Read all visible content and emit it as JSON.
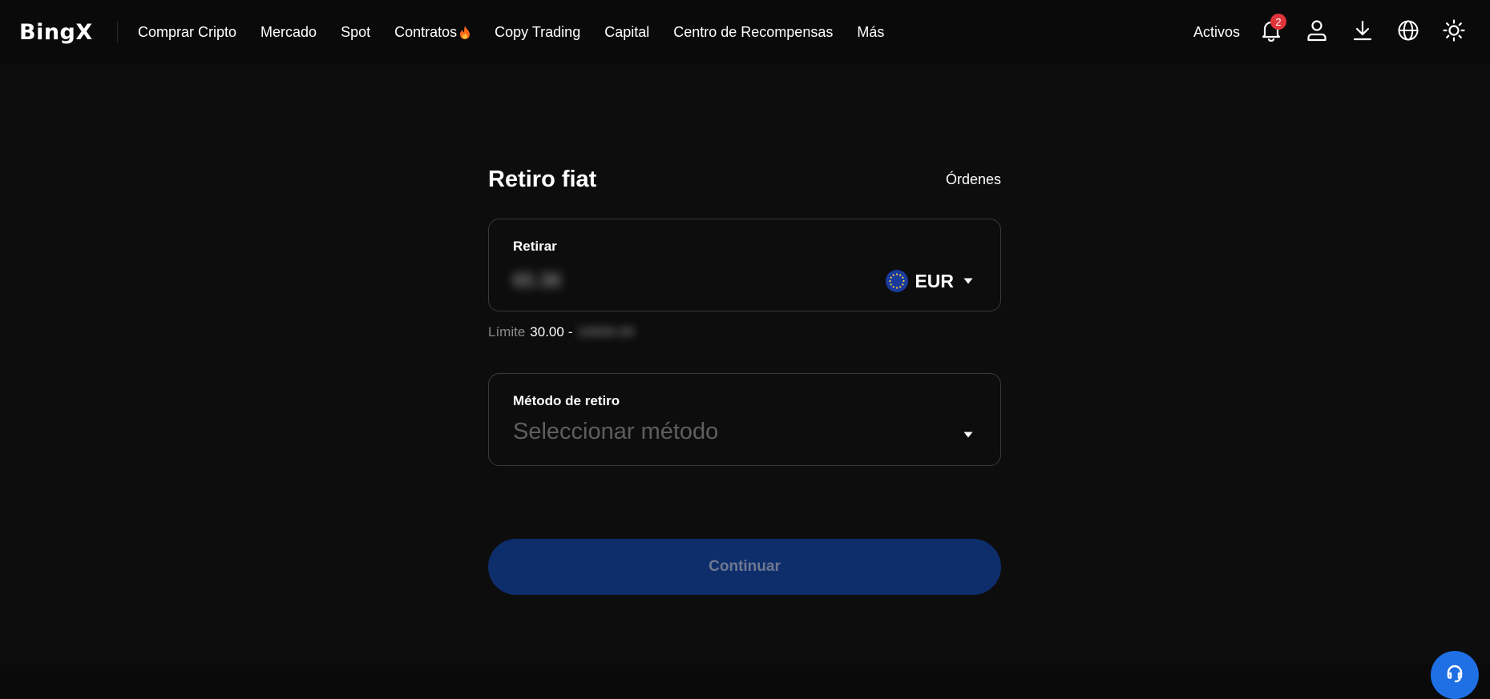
{
  "header": {
    "logo_text": "BingX",
    "nav": [
      {
        "label": "Comprar Cripto"
      },
      {
        "label": "Mercado"
      },
      {
        "label": "Spot"
      },
      {
        "label": "Contratos"
      },
      {
        "label": "Copy Trading"
      },
      {
        "label": "Capital"
      },
      {
        "label": "Centro de Recompensas"
      },
      {
        "label": "Más"
      }
    ],
    "assets_label": "Activos",
    "notification_count": "2",
    "icons": [
      "bell-icon",
      "user-icon",
      "download-icon",
      "globe-icon",
      "sun-icon"
    ]
  },
  "withdraw": {
    "title": "Retiro fiat",
    "orders_label": "Órdenes",
    "amount_label": "Retirar",
    "amount_value": "65.36",
    "currency": "EUR",
    "limit_label": "Límite",
    "limit_min": "30.00",
    "limit_separator": "-",
    "limit_max": "10000.00",
    "method_label": "Método de retiro",
    "method_placeholder": "Seleccionar método",
    "continue_label": "Continuar"
  },
  "colors": {
    "background": "#0d0d0d",
    "card_border": "#3a3a3a",
    "button": "#0e2d6b",
    "button_text": "#6d7891",
    "badge": "#e0343b",
    "support": "#1f6fe5"
  }
}
